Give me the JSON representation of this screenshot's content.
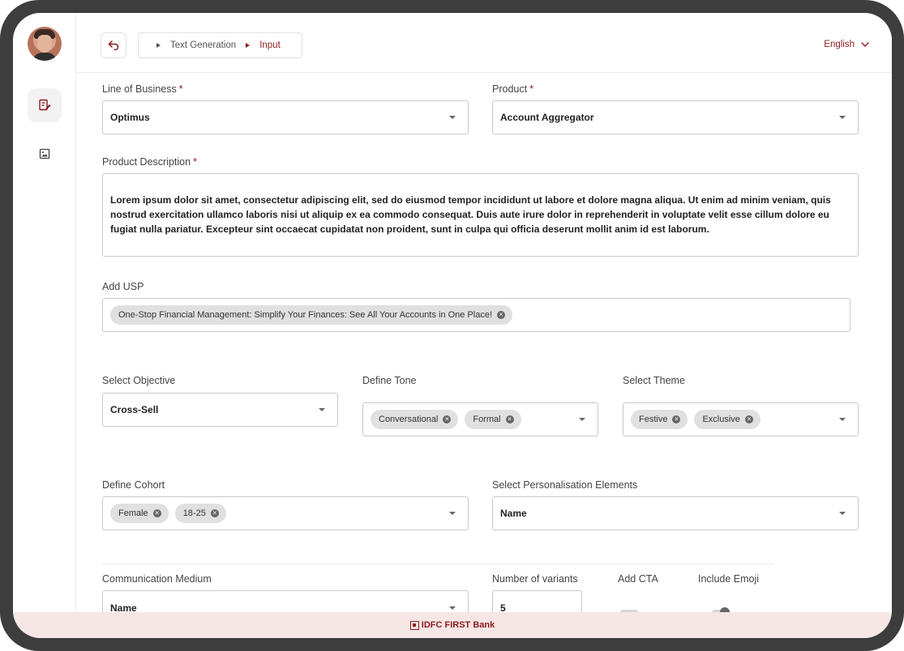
{
  "breadcrumb": {
    "items": [
      "Text Generation",
      "Input"
    ]
  },
  "language": {
    "selected": "English"
  },
  "form": {
    "line_of_business": {
      "label": "Line of Business",
      "value": "Optimus"
    },
    "product": {
      "label": "Product",
      "value": "Account Aggregator"
    },
    "product_description": {
      "label": "Product Description",
      "value": "Lorem ipsum dolor sit amet, consectetur adipiscing elit, sed do eiusmod tempor incididunt ut labore et dolore magna aliqua. Ut enim ad minim veniam, quis nostrud exercitation ullamco laboris nisi ut aliquip ex ea commodo consequat. Duis aute irure dolor in reprehenderit in voluptate velit esse cillum dolore eu fugiat nulla pariatur. Excepteur sint occaecat cupidatat non proident, sunt in culpa qui officia deserunt mollit anim id est laborum."
    },
    "usp": {
      "label": "Add USP",
      "chips": [
        "One-Stop Financial Management: Simplify Your Finances: See All Your Accounts in One Place!"
      ]
    },
    "objective": {
      "label": "Select Objective",
      "value": "Cross-Sell"
    },
    "tone": {
      "label": "Define Tone",
      "chips": [
        "Conversational",
        "Formal"
      ]
    },
    "theme": {
      "label": "Select Theme",
      "chips": [
        "Festive",
        "Exclusive"
      ]
    },
    "cohort": {
      "label": "Define Cohort",
      "chips": [
        "Female",
        "18-25"
      ]
    },
    "personalisation": {
      "label": "Select Personalisation Elements",
      "value": "Name"
    },
    "communication_medium": {
      "label": "Communication Medium",
      "value": "Name"
    },
    "variants": {
      "label": "Number of variants",
      "value": "5"
    },
    "cta": {
      "label": "Add CTA"
    },
    "emoji": {
      "label": "Include Emoji"
    }
  },
  "required_mark": "*",
  "footer": {
    "brand": "IDFC FIRST Bank"
  },
  "icons": {
    "back": "back-arrow-icon",
    "text_gen": "document-edit-icon",
    "image_gen": "image-icon",
    "lang_dropdown": "chevron-down-icon"
  },
  "colors": {
    "accent": "#8b1c1c",
    "footer_bg": "#f6e6e6",
    "chip_bg": "#e0e0e0"
  }
}
